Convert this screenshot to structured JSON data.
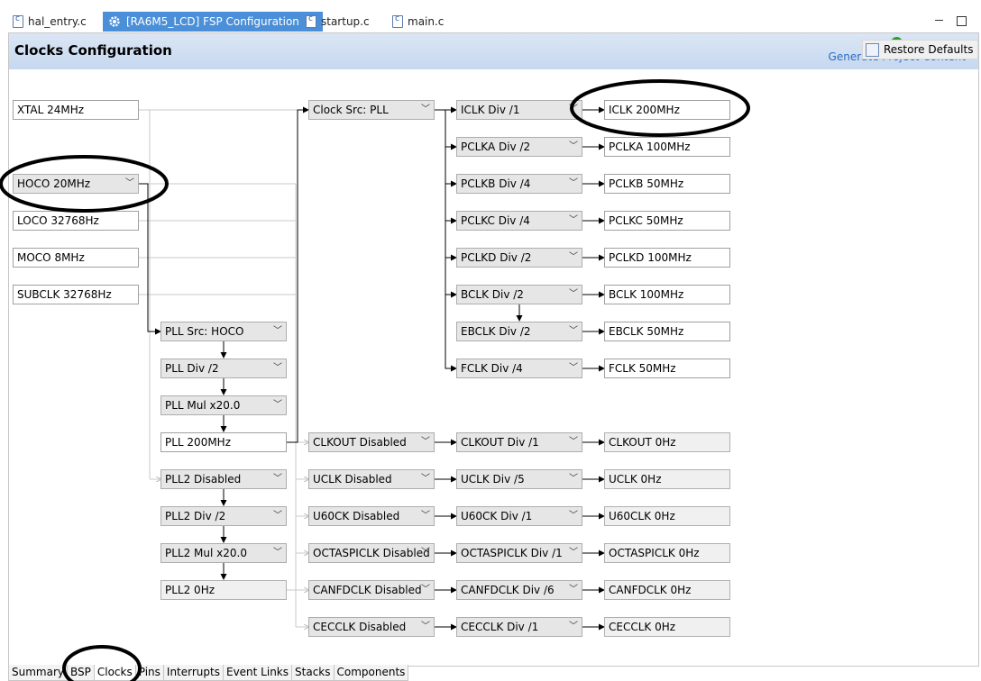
{
  "tabs": [
    {
      "label": "hal_entry.c",
      "active": false,
      "icon": "c-file-icon"
    },
    {
      "label": "[RA6M5_LCD] FSP Configuration",
      "active": true,
      "icon": "gear-icon"
    },
    {
      "label": "startup.c",
      "active": false,
      "icon": "c-file-icon"
    },
    {
      "label": "main.c",
      "active": false,
      "icon": "c-file-icon"
    }
  ],
  "header": {
    "title": "Clocks Configuration",
    "generate_label": "Generate Project Content",
    "restore_label": "Restore Defaults"
  },
  "sources": {
    "xtal": "XTAL 24MHz",
    "hoco": "HOCO 20MHz",
    "loco": "LOCO 32768Hz",
    "moco": "MOCO 8MHz",
    "subclk": "SUBCLK 32768Hz"
  },
  "pll": {
    "src": "PLL Src: HOCO",
    "div": "PLL Div /2",
    "mul": "PLL Mul x20.0",
    "out": "PLL 200MHz",
    "pll2": "PLL2 Disabled",
    "pll2_div": "PLL2 Div /2",
    "pll2_mul": "PLL2 Mul x20.0",
    "pll2_out": "PLL2 0Hz"
  },
  "clock_src": "Clock Src: PLL",
  "dividers": [
    {
      "div": "ICLK Div /1",
      "out": "ICLK 200MHz"
    },
    {
      "div": "PCLKA Div /2",
      "out": "PCLKA 100MHz"
    },
    {
      "div": "PCLKB Div /4",
      "out": "PCLKB 50MHz"
    },
    {
      "div": "PCLKC Div /4",
      "out": "PCLKC 50MHz"
    },
    {
      "div": "PCLKD Div /2",
      "out": "PCLKD 100MHz"
    },
    {
      "div": "BCLK Div /2",
      "out": "BCLK 100MHz"
    },
    {
      "div": "EBCLK Div /2",
      "out": "EBCLK 50MHz"
    },
    {
      "div": "FCLK Div /4",
      "out": "FCLK 50MHz"
    }
  ],
  "peripherals": [
    {
      "src": "CLKOUT Disabled",
      "div": "CLKOUT Div /1",
      "out": "CLKOUT 0Hz"
    },
    {
      "src": "UCLK Disabled",
      "div": "UCLK Div /5",
      "out": "UCLK 0Hz"
    },
    {
      "src": "U60CK Disabled",
      "div": "U60CK Div /1",
      "out": "U60CLK 0Hz"
    },
    {
      "src": "OCTASPICLK Disabled",
      "div": "OCTASPICLK Div /1",
      "out": "OCTASPICLK 0Hz"
    },
    {
      "src": "CANFDCLK Disabled",
      "div": "CANFDCLK Div /6",
      "out": "CANFDCLK 0Hz"
    },
    {
      "src": "CECCLK Disabled",
      "div": "CECCLK Div /1",
      "out": "CECCLK 0Hz"
    }
  ],
  "bottom_tabs": [
    "Summary",
    "BSP",
    "Clocks",
    "Pins",
    "Interrupts",
    "Event Links",
    "Stacks",
    "Components"
  ],
  "active_bottom_tab": "Clocks",
  "colors": {
    "tab_active": "#4a8fd8",
    "header": "#c6d8ef",
    "link": "#2a6cc5",
    "annotation": "#000000"
  }
}
